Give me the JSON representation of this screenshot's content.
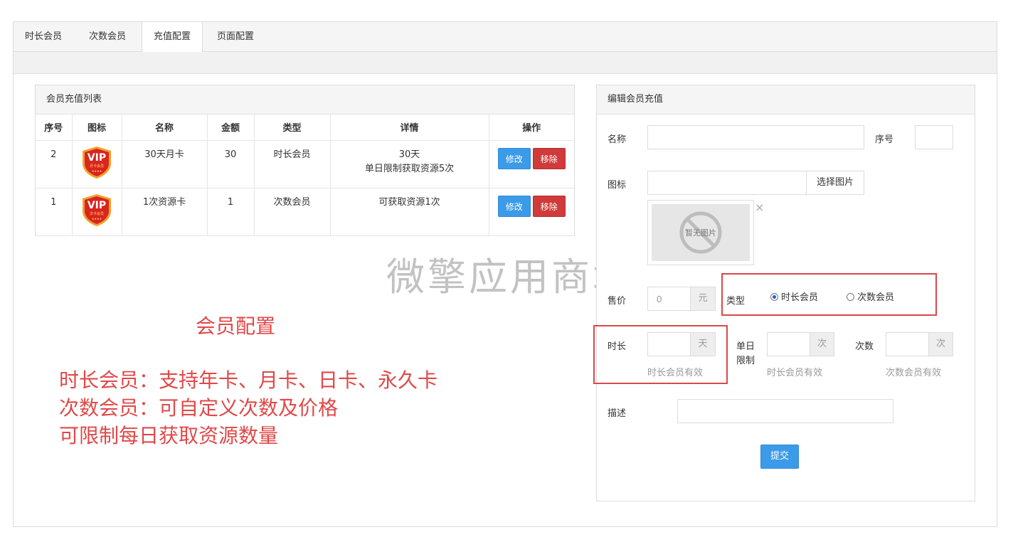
{
  "tabs": [
    {
      "label": "时长会员",
      "active": false
    },
    {
      "label": "次数会员",
      "active": false
    },
    {
      "label": "充值配置",
      "active": true
    },
    {
      "label": "页面配置",
      "active": false
    }
  ],
  "list": {
    "title": "会员充值列表",
    "columns": [
      "序号",
      "图标",
      "名称",
      "金额",
      "类型",
      "详情",
      "操作"
    ],
    "rows": [
      {
        "seq": "2",
        "icon": "vip-month-card-icon",
        "name": "30天月卡",
        "amount": "30",
        "type": "时长会员",
        "detail_line1": "30天",
        "detail_line2": "单日限制获取资源5次",
        "badge_sub": "月卡会员"
      },
      {
        "seq": "1",
        "icon": "vip-count-card-icon",
        "name": "1次资源卡",
        "amount": "1",
        "type": "次数会员",
        "detail_line1": "可获取资源1次",
        "detail_line2": "",
        "badge_sub": "次卡会员"
      }
    ],
    "edit_label": "修改",
    "remove_label": "移除",
    "badge_text": "VIP"
  },
  "watermark": "微擎应用商城",
  "annotation": {
    "title": "会员配置",
    "lines": [
      "时长会员：支持年卡、月卡、日卡、永久卡",
      "次数会员：可自定义次数及价格",
      "可限制每日获取资源数量"
    ]
  },
  "edit": {
    "title": "编辑会员充值",
    "name_label": "名称",
    "name_value": "",
    "seq_label": "序号",
    "seq_value": "",
    "icon_label": "图标",
    "icon_value": "",
    "choose_image": "选择图片",
    "no_image": "暂无图片",
    "remove_image": "×",
    "price_label": "售价",
    "price_value": "0",
    "price_unit": "元",
    "type_label": "类型",
    "type_options": [
      "时长会员",
      "次数会员"
    ],
    "type_selected": "时长会员",
    "duration_label": "时长",
    "duration_unit": "天",
    "duration_hint": "时长会员有效",
    "daily_limit_label_1": "单日",
    "daily_limit_label_2": "限制",
    "daily_limit_unit": "次",
    "daily_limit_hint": "时长会员有效",
    "count_label": "次数",
    "count_unit": "次",
    "count_hint": "次数会员有效",
    "desc_label": "描述",
    "desc_value": "",
    "submit": "提交"
  },
  "colors": {
    "primary": "#3c9be9",
    "danger": "#d03a3a",
    "annotation": "#e04848",
    "highlight_box": "#d9484b"
  }
}
